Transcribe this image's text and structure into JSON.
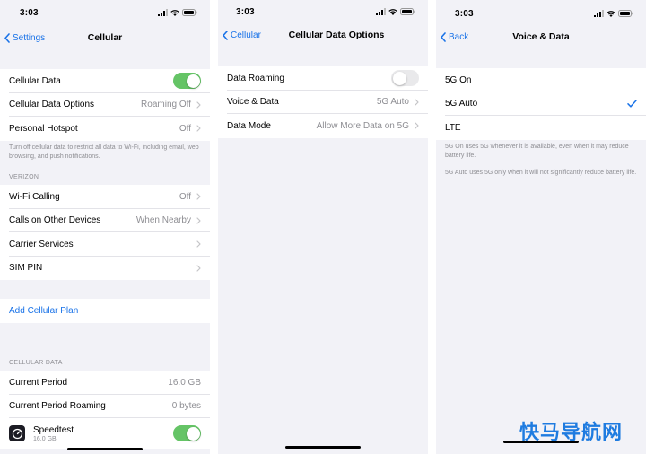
{
  "status_bar": {
    "time": "3:03"
  },
  "screen1": {
    "nav": {
      "back_label": "Settings",
      "title": "Cellular"
    },
    "rows_top": [
      {
        "label": "Cellular Data",
        "toggle": "on"
      },
      {
        "label": "Cellular Data Options",
        "value": "Roaming Off"
      },
      {
        "label": "Personal Hotspot",
        "value": "Off"
      }
    ],
    "footnote": "Turn off cellular data to restrict all data to Wi-Fi, including email, web browsing, and push notifications.",
    "carrier_header": "VERIZON",
    "rows_carrier": [
      {
        "label": "Wi-Fi Calling",
        "value": "Off"
      },
      {
        "label": "Calls on Other Devices",
        "value": "When Nearby"
      },
      {
        "label": "Carrier Services",
        "value": ""
      },
      {
        "label": "SIM PIN",
        "value": ""
      }
    ],
    "add_plan": "Add Cellular Plan",
    "data_header": "CELLULAR DATA",
    "rows_data": [
      {
        "label": "Current Period",
        "value": "16.0 GB"
      },
      {
        "label": "Current Period Roaming",
        "value": "0 bytes"
      }
    ],
    "app_row": {
      "name": "Speedtest",
      "size": "16.0 GB",
      "toggle": "on",
      "icon": "speedometer-icon"
    }
  },
  "screen2": {
    "nav": {
      "back_label": "Cellular",
      "title": "Cellular Data Options"
    },
    "rows": [
      {
        "label": "Data Roaming",
        "toggle": "off"
      },
      {
        "label": "Voice & Data",
        "value": "5G Auto"
      },
      {
        "label": "Data Mode",
        "value": "Allow More Data on 5G"
      }
    ]
  },
  "screen3": {
    "nav": {
      "back_label": "Back",
      "title": "Voice & Data"
    },
    "options": [
      {
        "label": "5G On",
        "selected": false
      },
      {
        "label": "5G Auto",
        "selected": true
      },
      {
        "label": "LTE",
        "selected": false
      }
    ],
    "note1": "5G On uses 5G whenever it is available, even when it may reduce battery life.",
    "note2": "5G Auto uses 5G only when it will not significantly reduce battery life."
  },
  "watermark": "快马导航网",
  "colors": {
    "accent": "#1a73e8",
    "toggle_on": "#65c466",
    "background": "#f2f2f7",
    "secondary_text": "#8e8e93"
  }
}
